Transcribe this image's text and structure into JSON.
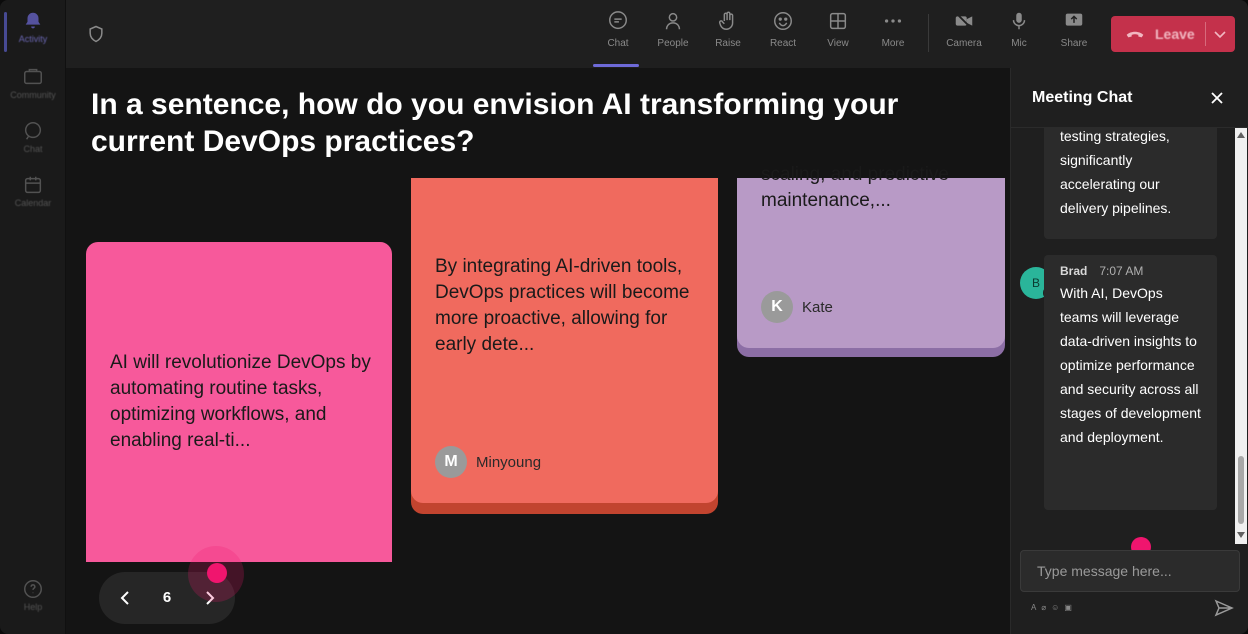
{
  "rail": {
    "items": [
      {
        "label": "Activity"
      },
      {
        "label": "Community"
      },
      {
        "label": "Chat"
      },
      {
        "label": "Calendar"
      }
    ],
    "help_label": "Help"
  },
  "toolbar": {
    "buttons": [
      {
        "label": "Chat"
      },
      {
        "label": "People"
      },
      {
        "label": "Raise"
      },
      {
        "label": "React"
      },
      {
        "label": "View"
      },
      {
        "label": "More"
      },
      {
        "label": "Camera"
      },
      {
        "label": "Mic"
      },
      {
        "label": "Share"
      }
    ],
    "leave_label": "Leave"
  },
  "board": {
    "question": "In a sentence, how do you envision AI transforming your current DevOps practices?",
    "cards": [
      {
        "text": "AI will revolutionize DevOps by automating routine tasks, optimizing workflows, and enabling real-ti...",
        "author": "",
        "initial": "",
        "color": "#f7599b"
      },
      {
        "text": "By integrating AI-driven tools, DevOps practices will become more proactive, allowing for early dete...",
        "author": "Minyoung",
        "initial": "M",
        "color": "#f06a5e"
      },
      {
        "text": "scaling, and predictive maintenance,...",
        "author": "Kate",
        "initial": "K",
        "color": "#b89ac6"
      }
    ],
    "pager": {
      "page": "6"
    }
  },
  "chat": {
    "title": "Meeting Chat",
    "messages": [
      {
        "sender": "",
        "time": "",
        "text": "testing strategies, significantly accelerating our delivery pipelines."
      },
      {
        "sender": "Brad",
        "initial": "B",
        "time": "7:07 AM",
        "text": "With AI, DevOps teams will leverage data-driven insights to optimize performance and security across all stages of development and deployment."
      }
    ],
    "input_placeholder": "Type message here...",
    "accent": "#2ab59a"
  },
  "colors": {
    "leave": "#c4314b",
    "cursor": "#f0156e",
    "active_tab": "#6e6ad8"
  }
}
